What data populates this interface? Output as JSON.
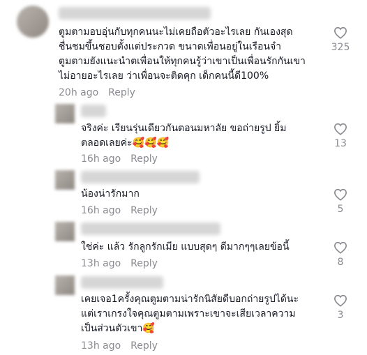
{
  "comments": [
    {
      "text": "ตูมตามอบอุ่นกับทุกคนนะไม่เคยถือตัวอะไรเลย กันเองสุด\nชื่นชมขึ้นชอบตั้งแต่ประกวด ขนาดเพื่อนอยู่ในเรือนจำ\nตูมตามยังแนะนำตเพื่อนให้ทุกคนรู้ว่าเขาเป็นเพื่อนรักกันเขา\nไม่อายอะไรเลย ว่าเพื่อนจะติดคุก เด็กคนนี้ดี100%",
      "time": "20h ago",
      "reply": "Reply",
      "likes": "325"
    },
    {
      "text": "จริงค่ะ เรียนรุ่นเดียวกันตอนมหาลัย ขอถ่ายรูป ยิ้ม\nตลอดเลยค่ะ🥰🥰🥰",
      "time": "16h ago",
      "reply": "Reply",
      "likes": "13"
    },
    {
      "text": "น้องน่ารักมาก",
      "time": "16h ago",
      "reply": "Reply",
      "likes": "5"
    },
    {
      "text": "ใช่ค่ะ แล้ว รักลูกรักเมีย แบบสุดๆ ดีมากๆๆเลยข้อนี้",
      "time": "13h ago",
      "reply": "Reply",
      "likes": "8"
    },
    {
      "text": "เคยเจอ1ครั้งคุณตูมตามน่ารักนิสัยดีบอกถ่ายรูปได้นะ\nแต่เราเกรงใจคุณตูมตามเพราะเขาจะเสียเวลาความ\nเป็นส่วนตัวเขา🥰",
      "time": "13h ago",
      "reply": "Reply",
      "likes": "3"
    }
  ]
}
